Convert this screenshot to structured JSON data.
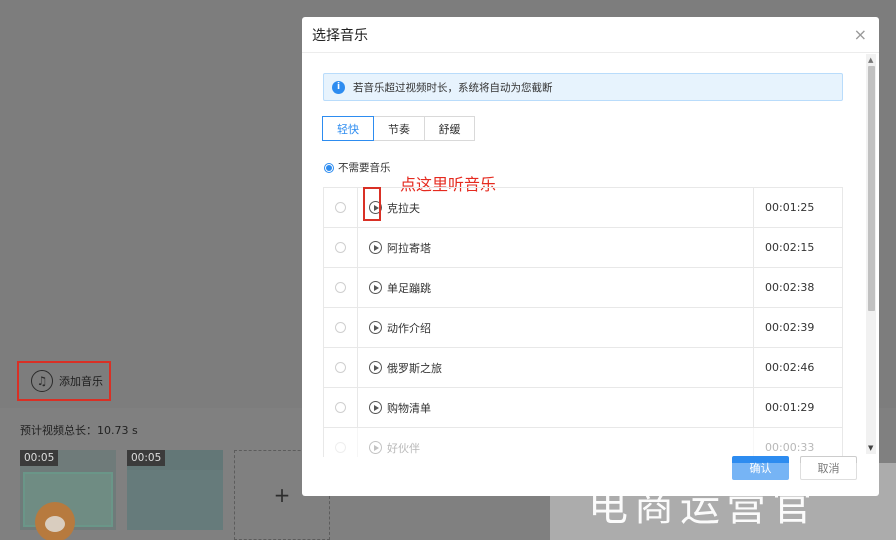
{
  "background": {
    "add_music_label": "添加音乐",
    "add_music_icon": "music-note-icon",
    "total_duration": "预计视频总长：10.73 s",
    "clips": [
      {
        "duration": "00:05"
      },
      {
        "duration": "00:05"
      }
    ],
    "add_clip_label": "+"
  },
  "modal": {
    "title": "选择音乐",
    "close_icon": "×",
    "notice": "若音乐超过视频时长，系统将自动为您截断",
    "tabs": [
      "轻快",
      "节奏",
      "舒缓"
    ],
    "active_tab": "轻快",
    "no_music_label": "不需要音乐",
    "annotation": "点这里听音乐",
    "tracks": [
      {
        "name": "克拉夫",
        "duration": "00:01:25"
      },
      {
        "name": "阿拉寄塔",
        "duration": "00:02:15"
      },
      {
        "name": "单足蹦跳",
        "duration": "00:02:38"
      },
      {
        "name": "动作介绍",
        "duration": "00:02:39"
      },
      {
        "name": "俄罗斯之旅",
        "duration": "00:02:46"
      },
      {
        "name": "购物清单",
        "duration": "00:01:29"
      },
      {
        "name": "好伙伴",
        "duration": "00:00:33"
      }
    ],
    "confirm_label": "确认",
    "cancel_label": "取消"
  },
  "watermark": "电商运营官",
  "colors": {
    "accent": "#2d8cf0",
    "annotation_red": "#e52a1f"
  }
}
